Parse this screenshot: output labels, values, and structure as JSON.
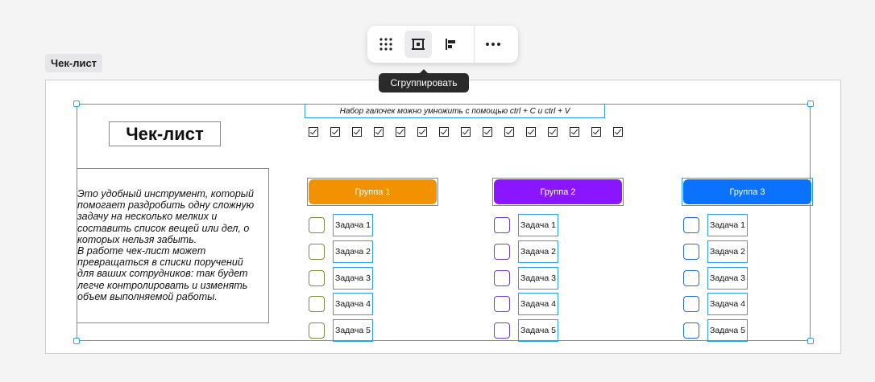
{
  "frame": {
    "label": "Чек-лист"
  },
  "toolbar": {
    "buttons": [
      {
        "icon": "grid-dots-icon"
      },
      {
        "icon": "group-frame-icon",
        "active": true
      },
      {
        "icon": "align-left-icon"
      },
      {
        "icon": "more-icon"
      }
    ],
    "tooltip": "Сгруппировать"
  },
  "content": {
    "title": "Чек-лист",
    "hint": "Набор галочек можно умножить с помощью ctrl + C и ctrl + V",
    "checkmark_count": 15,
    "description": "Это удобный инструмент, который\nпомогает раздробить одну сложную\nзадачу на несколько мелких и\nсоставить список вещей или дел, о\nкоторых нельзя забыть.\nВ работе чек-лист может\nпревращаться в списки поручений\nдля ваших сотрудников: так будет\nлегче контролировать и изменять\nобъем выполняемой работы."
  },
  "groups": [
    {
      "name": "Группа 1",
      "color": "#f39200",
      "box_color": "#7d8c3b",
      "tasks": [
        "Задача 1",
        "Задача 2",
        "Задача 3",
        "Задача 4",
        "Задача 5"
      ]
    },
    {
      "name": "Группа 2",
      "color": "#8a16ff",
      "box_color": "#6a3fd6",
      "tasks": [
        "Задача 1",
        "Задача 2",
        "Задача 3",
        "Задача 4",
        "Задача 5"
      ]
    },
    {
      "name": "Группа 3",
      "color": "#0a72ff",
      "box_color": "#1f6fd6",
      "tasks": [
        "Задача 1",
        "Задача 2",
        "Задача 3",
        "Задача 4",
        "Задача 5"
      ]
    }
  ]
}
